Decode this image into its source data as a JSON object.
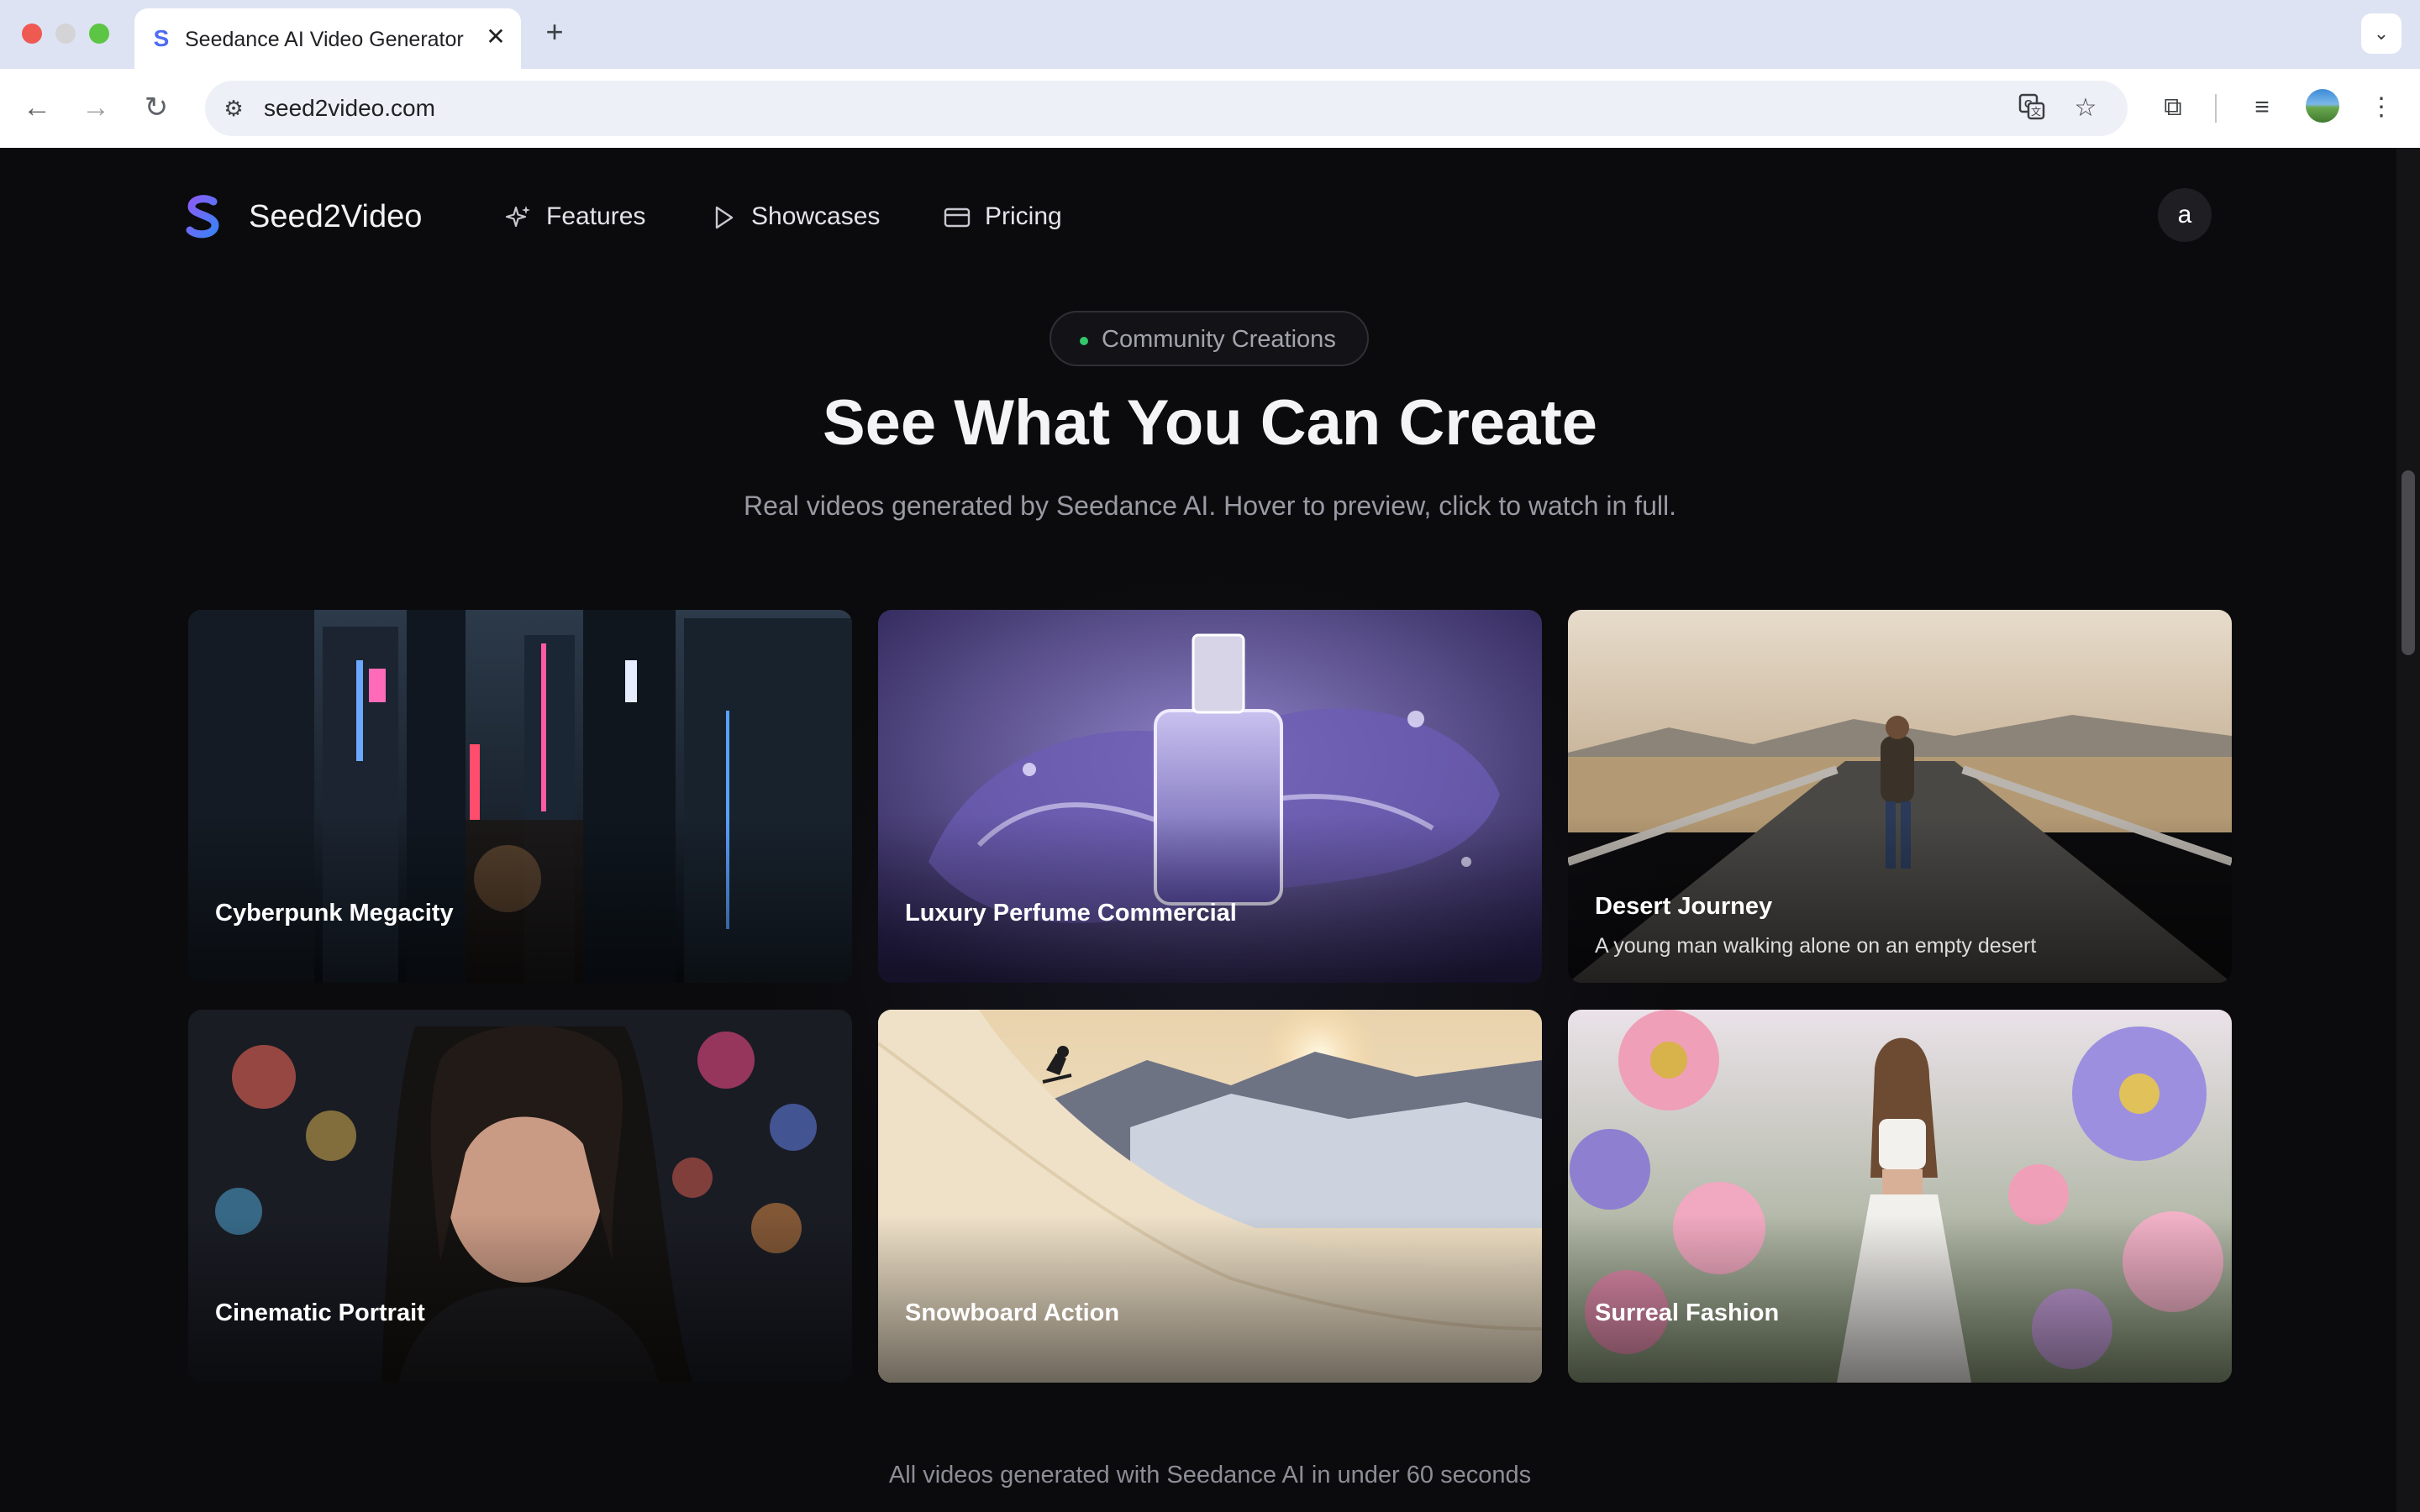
{
  "browser": {
    "tab_title": "Seedance AI Video Generator",
    "tab_favicon": "S",
    "tab_close": "✕",
    "new_tab": "+",
    "tab_menu": "⌄",
    "url": "seed2video.com",
    "back": "←",
    "forward": "→",
    "reload": "↻",
    "site_info": "⚙",
    "translate_icon": "translate-icon",
    "bookmark": "☆",
    "extensions": "⧉",
    "media": "≡",
    "menu": "⋮"
  },
  "nav": {
    "brand": "Seed2Video",
    "links": [
      {
        "label": "Features",
        "icon": "sparkles-icon"
      },
      {
        "label": "Showcases",
        "icon": "play-icon"
      },
      {
        "label": "Pricing",
        "icon": "credit-card-icon"
      }
    ],
    "user_initial": "a"
  },
  "hero": {
    "badge": "Community Creations",
    "title": "See What You Can Create",
    "subtitle": "Real videos generated by Seedance AI. Hover to preview, click to watch in full."
  },
  "cards": [
    {
      "title": "Cyberpunk Megacity",
      "description": ""
    },
    {
      "title": "Luxury Perfume Commercial",
      "description": ""
    },
    {
      "title": "Desert Journey",
      "description": "A young man walking alone on an empty desert"
    },
    {
      "title": "Cinematic Portrait",
      "description": ""
    },
    {
      "title": "Snowboard Action",
      "description": ""
    },
    {
      "title": "Surreal Fashion",
      "description": ""
    }
  ],
  "footnote": "All videos generated with Seedance AI in under 60 seconds",
  "colors": {
    "page_bg": "#0b0b0d",
    "badge_dot": "#34c76a",
    "logo_gradient_start": "#8a5cf6",
    "logo_gradient_end": "#3b82f6"
  }
}
